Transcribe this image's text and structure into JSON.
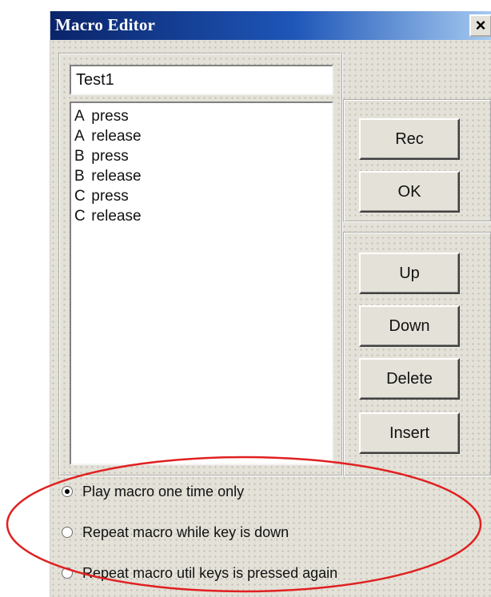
{
  "window": {
    "title": "Macro Editor",
    "close_label": "×"
  },
  "macro_name": {
    "value": "Test1"
  },
  "events": [
    {
      "key": "A",
      "action": "press"
    },
    {
      "key": "A",
      "action": "release"
    },
    {
      "key": "B",
      "action": "press"
    },
    {
      "key": "B",
      "action": "release"
    },
    {
      "key": "C",
      "action": "press"
    },
    {
      "key": "C",
      "action": "release"
    }
  ],
  "buttons": {
    "rec": "Rec",
    "ok": "OK",
    "up": "Up",
    "down": "Down",
    "delete": "Delete",
    "insert": "Insert"
  },
  "options": [
    {
      "label": "Play macro one time only",
      "checked": true
    },
    {
      "label": "Repeat macro while key is down",
      "checked": false
    },
    {
      "label": "Repeat macro util keys is pressed again",
      "checked": false
    }
  ],
  "annotation": {
    "ellipse_color": "#e02020"
  }
}
